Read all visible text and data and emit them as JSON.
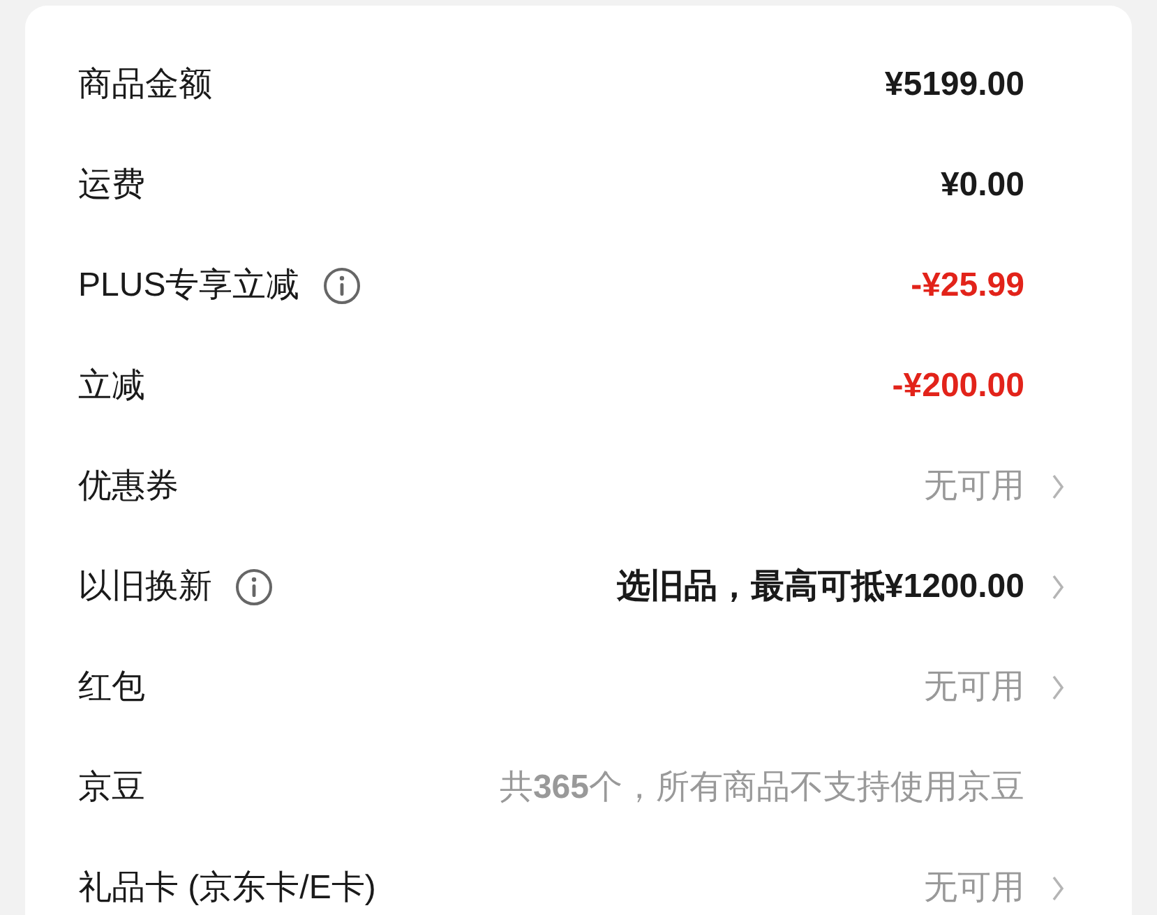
{
  "rows": [
    {
      "label": "商品金额",
      "info": false,
      "value": "¥5199.00",
      "color": "#1a1a1a",
      "bold": true,
      "arrow": false
    },
    {
      "label": "运费",
      "info": false,
      "value": "¥0.00",
      "color": "#1a1a1a",
      "bold": true,
      "arrow": false
    },
    {
      "label": "PLUS专享立减",
      "info": true,
      "value": "-¥25.99",
      "color": "#e2231a",
      "bold": true,
      "arrow": false
    },
    {
      "label": "立减",
      "info": false,
      "value": "-¥200.00",
      "color": "#e2231a",
      "bold": true,
      "arrow": false
    },
    {
      "label": "优惠券",
      "info": false,
      "value": "无可用",
      "color": "#999999",
      "bold": false,
      "arrow": true
    },
    {
      "label": "以旧换新",
      "info": true,
      "value": "选旧品，最高可抵¥1200.00",
      "color": "#1a1a1a",
      "bold": true,
      "arrow": true
    },
    {
      "label": "红包",
      "info": false,
      "value": "无可用",
      "color": "#999999",
      "bold": false,
      "arrow": true
    },
    {
      "label": "京豆",
      "info": false,
      "value": "共**365**个，所有商品不支持使用京豆",
      "color": "#999999",
      "bold": false,
      "arrow": false
    },
    {
      "label": "礼品卡 (京东卡/E卡)",
      "info": false,
      "value": "无可用",
      "color": "#999999",
      "bold": false,
      "arrow": true
    }
  ]
}
